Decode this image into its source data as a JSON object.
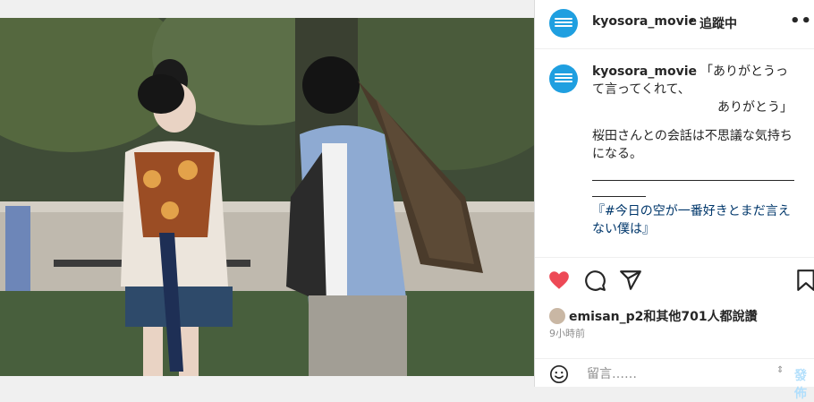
{
  "post": {
    "image_alt": "",
    "account": {
      "username": "kyosora_movie",
      "separator": "•",
      "follow_status": "追蹤中",
      "more_label": "•••"
    },
    "caption": {
      "username": "kyosora_movie",
      "line1": "「ありがとうって言ってくれて、",
      "line2": "ありがとう」",
      "line3": "桜田さんとの会話は不思議な気持ちになる。",
      "hashtag": "『#今日の空が一番好きとまだ言えない僕は』"
    },
    "actions": {
      "like_icon": "heart-filled-icon",
      "comment_icon": "comment-icon",
      "share_icon": "share-icon",
      "save_icon": "bookmark-icon",
      "like_color": "#ed4956"
    },
    "likes": {
      "liker": "emisan_p2",
      "text": "和其他701人都說讚"
    },
    "time": "9小時前",
    "comment": {
      "emoji_icon": "emoji-icon",
      "placeholder": "留言……",
      "post_label": "發佈"
    }
  }
}
